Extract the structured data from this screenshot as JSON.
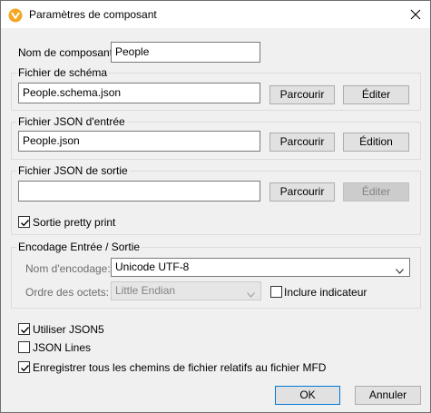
{
  "window": {
    "title": "Paramètres de composant",
    "icon": "altova-mapforce-icon",
    "close_icon": "close-icon"
  },
  "component_name": {
    "label": "Nom de composant:",
    "value": "People"
  },
  "schema_group": {
    "title": "Fichier de schéma",
    "value": "People.schema.json",
    "browse_label": "Parcourir",
    "edit_label": "Éditer"
  },
  "input_group": {
    "title": "Fichier JSON d'entrée",
    "value": "People.json",
    "browse_label": "Parcourir",
    "edit_label": "Édition"
  },
  "output_group": {
    "title": "Fichier JSON de sortie",
    "value": "",
    "browse_label": "Parcourir",
    "edit_label": "Éditer",
    "edit_disabled": true,
    "pretty_print_label": "Sortie pretty print",
    "pretty_print_checked": true
  },
  "encoding_group": {
    "title": "Encodage Entrée / Sortie",
    "encoding_label": "Nom d'encodage:",
    "encoding_value": "Unicode UTF-8",
    "byte_order_label": "Ordre des octets:",
    "byte_order_value": "Little Endian",
    "byte_order_disabled": true,
    "include_bom_label": "Inclure indicateur",
    "include_bom_checked": false
  },
  "options": {
    "json5_label": "Utiliser JSON5",
    "json5_checked": true,
    "json_lines_label": "JSON Lines",
    "json_lines_checked": false,
    "relative_paths_label": "Enregistrer tous les chemins de fichier relatifs au fichier MFD",
    "relative_paths_checked": true
  },
  "footer": {
    "ok_label": "OK",
    "cancel_label": "Annuler"
  }
}
